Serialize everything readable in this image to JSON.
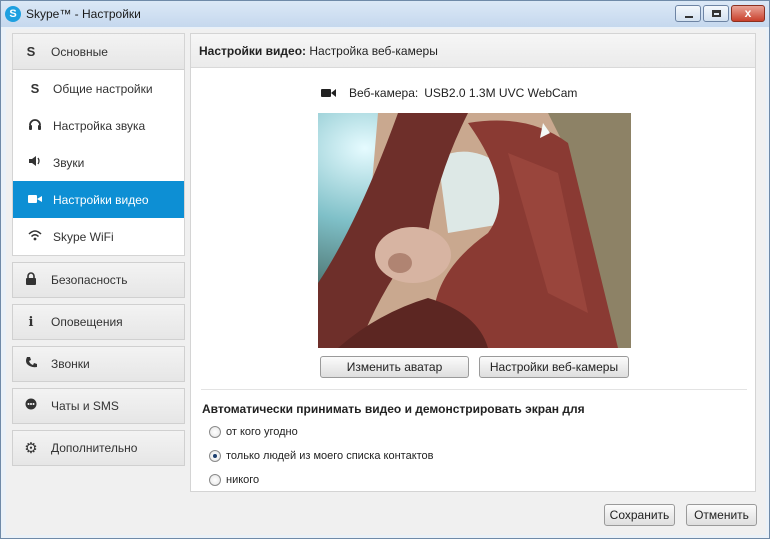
{
  "window": {
    "title": "Skype™ - Настройки",
    "close_glyph": "x"
  },
  "sidebar": {
    "top_category": {
      "label": "Основные",
      "icon": "skype-icon"
    },
    "items": [
      {
        "label": "Общие настройки",
        "icon": "skype-icon"
      },
      {
        "label": "Настройка звука",
        "icon": "headset-icon"
      },
      {
        "label": "Звуки",
        "icon": "speaker-icon"
      },
      {
        "label": "Настройки видео",
        "icon": "video-camera-icon",
        "active": true
      },
      {
        "label": "Skype WiFi",
        "icon": "wifi-icon"
      }
    ],
    "categories": [
      {
        "label": "Безопасность",
        "icon": "lock-icon"
      },
      {
        "label": "Оповещения",
        "icon": "info-icon"
      },
      {
        "label": "Звонки",
        "icon": "phone-icon"
      },
      {
        "label": "Чаты и SMS",
        "icon": "chat-icon"
      },
      {
        "label": "Дополнительно",
        "icon": "gear-icon"
      }
    ]
  },
  "panel": {
    "heading_bold": "Настройки видео:",
    "heading_rest": " Настройка веб-камеры",
    "webcam_label": "Веб-камера:",
    "webcam_value": "USB2.0 1.3M UVC WebCam",
    "change_avatar_label": "Изменить аватар",
    "webcam_settings_label": "Настройки веб-камеры",
    "auto_accept_title": "Автоматически принимать видео и демонстрировать экран для",
    "options": [
      {
        "label": "от кого угодно",
        "selected": false
      },
      {
        "label": "только людей из моего списка контактов",
        "selected": true
      },
      {
        "label": "никого",
        "selected": false
      }
    ]
  },
  "footer": {
    "save_label": "Сохранить",
    "cancel_label": "Отменить"
  },
  "colors": {
    "accent": "#0d8fd4",
    "skype_blue": "#1ea0e0"
  }
}
